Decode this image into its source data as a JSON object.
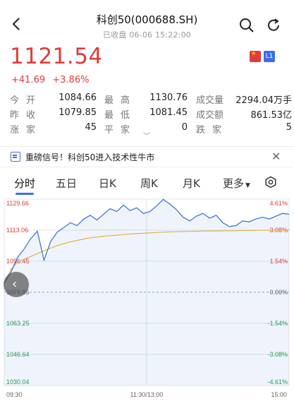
{
  "header": {
    "title": "科创50(000688.SH)",
    "status": "已收盘",
    "datetime": "06-06 15:22:00"
  },
  "quote": {
    "price": "1121.54",
    "change": "+41.69",
    "change_pct": "+3.86%",
    "level_badge": "L1"
  },
  "stats": {
    "open_label": "今开",
    "open": "1084.66",
    "high_label": "最高",
    "high": "1130.76",
    "volume_label": "成交量",
    "volume": "2294.04万手",
    "prev_close_label": "昨收",
    "prev_close": "1079.85",
    "low_label": "最低",
    "low": "1081.45",
    "turnover_label": "成交额",
    "turnover": "861.53亿",
    "up_label": "涨家",
    "up": "45",
    "flat_label": "平家",
    "flat": "0",
    "down_label": "跌家",
    "down": "5"
  },
  "banner": {
    "text": "重磅信号！科创50进入技术性牛市"
  },
  "tabs": [
    {
      "label": "分时"
    },
    {
      "label": "五日"
    },
    {
      "label": "日K"
    },
    {
      "label": "周K"
    },
    {
      "label": "月K"
    },
    {
      "label": "更多"
    }
  ],
  "chart_data": {
    "type": "line",
    "y_left_ticks": [
      "1129.66",
      "1113.06",
      "1096.45",
      "1079.85",
      "1063.25",
      "1046.64",
      "1030.04"
    ],
    "y_right_ticks": [
      "4.61%",
      "3.08%",
      "1.54%",
      "0.00%",
      "-1.54%",
      "-3.08%",
      "-4.61%"
    ],
    "x_ticks": [
      "09:30",
      "11:30/13:00",
      "15:00"
    ],
    "ylim": [
      1030.04,
      1129.66
    ],
    "baseline": 1079.85,
    "series": [
      {
        "color": "#2f6fd6",
        "values": [
          1084.66,
          1090.5,
          1098.4,
          1103.0,
          1108.5,
          1112.5,
          1097.0,
          1107.0,
          1112.0,
          1114.5,
          1117.0,
          1115.5,
          1119.0,
          1121.0,
          1118.5,
          1121.5,
          1124.5,
          1123.0,
          1126.5,
          1123.5,
          1125.0,
          1122.0,
          1123.0,
          1126.0,
          1129.5,
          1127.0,
          1124.0,
          1120.0,
          1118.0,
          1120.5,
          1122.0,
          1119.5,
          1121.0,
          1117.0,
          1115.0,
          1115.5,
          1118.0,
          1117.5,
          1119.0,
          1120.0,
          1119.0,
          1120.5,
          1122.0,
          1121.54
        ]
      },
      {
        "color": "#e0b24a",
        "values": [
          1084.66,
          1092.0,
          1096.0,
          1097.5,
          1099.0,
          1100.5,
          1102.0,
          1103.5,
          1104.8,
          1105.9,
          1106.8,
          1107.6,
          1108.3,
          1108.9,
          1109.4,
          1109.8,
          1110.1,
          1110.4,
          1110.7,
          1111.0,
          1111.2,
          1111.4,
          1111.6,
          1111.8,
          1112.0,
          1112.1,
          1112.2,
          1112.3,
          1112.4,
          1112.5,
          1112.55,
          1112.6,
          1112.65,
          1112.7,
          1112.75,
          1112.8,
          1112.85,
          1112.9,
          1112.95,
          1113.0,
          1113.0,
          1113.05,
          1113.1,
          1113.1
        ]
      }
    ]
  }
}
